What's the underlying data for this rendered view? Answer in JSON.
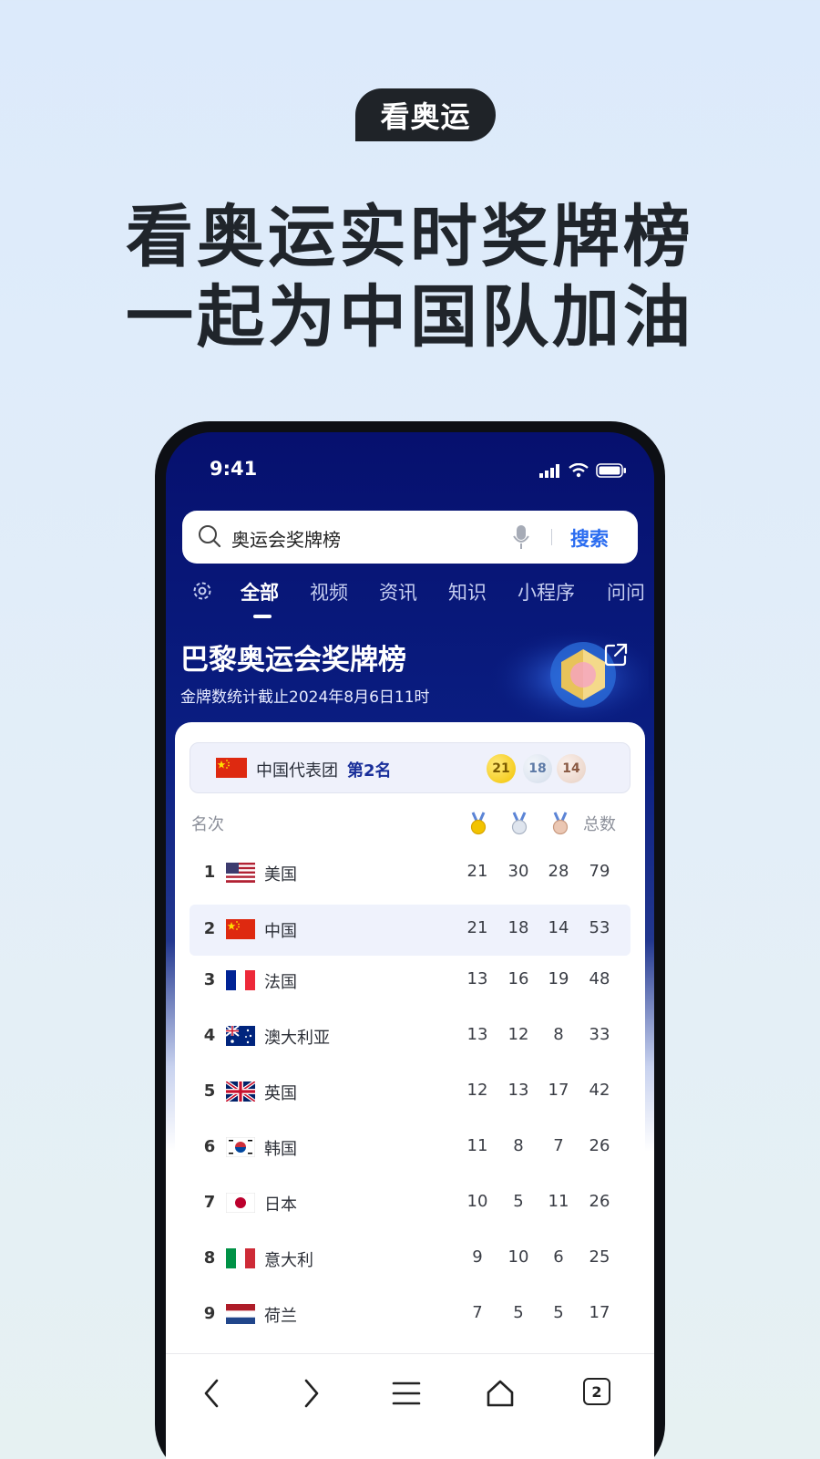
{
  "promo": {
    "pill": "看奥运",
    "headline_line1": "看奥运实时奖牌榜",
    "headline_line2": "一起为中国队加油"
  },
  "status_bar": {
    "time": "9:41"
  },
  "search": {
    "query": "奥运会奖牌榜",
    "button": "搜索"
  },
  "tabs": [
    "全部",
    "视频",
    "资讯",
    "知识",
    "小程序",
    "问问"
  ],
  "active_tab": "全部",
  "medal_table": {
    "title": "巴黎奥运会奖牌榜",
    "subtitle": "金牌数统计截止2024年8月6日11时",
    "banner": {
      "team": "中国代表团",
      "rank": "第2名",
      "gold": "21",
      "silver": "18",
      "bronze": "14"
    },
    "header": {
      "rank": "名次",
      "total": "总数"
    },
    "rows": [
      {
        "rank": "1",
        "country": "美国",
        "flag": "us-flag",
        "gold": "21",
        "silver": "30",
        "bronze": "28",
        "total": "79"
      },
      {
        "rank": "2",
        "country": "中国",
        "flag": "cn-flag",
        "gold": "21",
        "silver": "18",
        "bronze": "14",
        "total": "53"
      },
      {
        "rank": "3",
        "country": "法国",
        "flag": "fr-flag",
        "gold": "13",
        "silver": "16",
        "bronze": "19",
        "total": "48"
      },
      {
        "rank": "4",
        "country": "澳大利亚",
        "flag": "au-flag",
        "gold": "13",
        "silver": "12",
        "bronze": "8",
        "total": "33"
      },
      {
        "rank": "5",
        "country": "英国",
        "flag": "gb-flag",
        "gold": "12",
        "silver": "13",
        "bronze": "17",
        "total": "42"
      },
      {
        "rank": "6",
        "country": "韩国",
        "flag": "kr-flag",
        "gold": "11",
        "silver": "8",
        "bronze": "7",
        "total": "26"
      },
      {
        "rank": "7",
        "country": "日本",
        "flag": "jp-flag",
        "gold": "10",
        "silver": "5",
        "bronze": "11",
        "total": "26"
      },
      {
        "rank": "8",
        "country": "意大利",
        "flag": "it-flag",
        "gold": "9",
        "silver": "10",
        "bronze": "6",
        "total": "25"
      },
      {
        "rank": "9",
        "country": "荷兰",
        "flag": "nl-flag",
        "gold": "7",
        "silver": "5",
        "bronze": "5",
        "total": "17"
      }
    ]
  },
  "bottom_nav": {
    "tab_count": "2"
  },
  "colors": {
    "header_navy": "#06106e",
    "accent_blue": "#2a6cf0",
    "gold": "#f2c300",
    "silver": "#d2dcea",
    "bronze": "#e7cfc2"
  }
}
